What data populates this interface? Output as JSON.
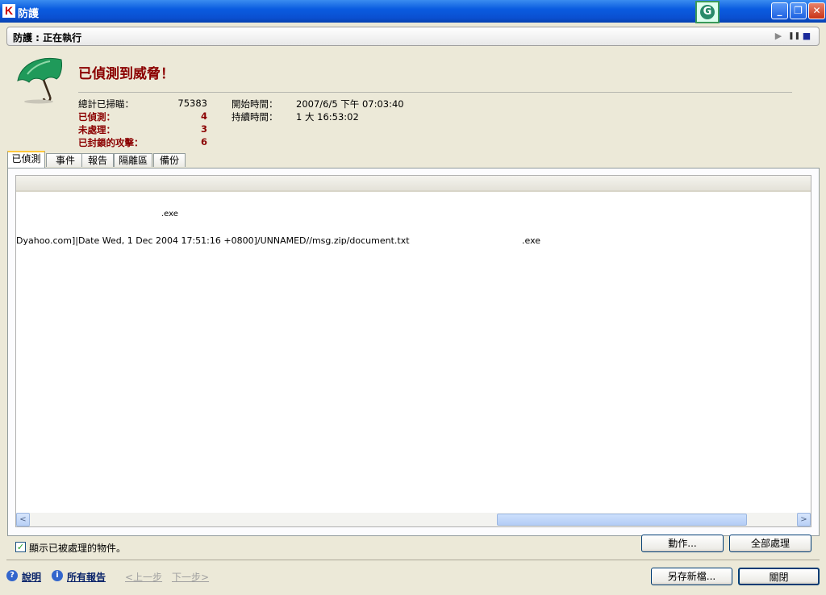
{
  "window": {
    "title": "防護",
    "app_icon_letter": "K",
    "tray_icon_letter": "G",
    "minimize_symbol": "_",
    "restore_symbol": "❐",
    "close_symbol": "✕"
  },
  "status": {
    "text": "防護 : 正在執行",
    "play_symbol": "▶",
    "pause_symbol": "❚❚",
    "stop_symbol": "■"
  },
  "summary": {
    "headline": "已偵測到威脅！",
    "stats": [
      {
        "label": "總計已掃瞄：",
        "value": "75383"
      },
      {
        "label": "已偵測：",
        "value": "4"
      },
      {
        "label": "未處理：",
        "value": "3"
      },
      {
        "label": "已封鎖的攻擊：",
        "value": "6"
      }
    ],
    "start_time_label": "開始時間：",
    "start_time_value": "2007/6/5 下午 07:03:40",
    "duration_label": "持續時間：",
    "duration_value": "1 大 16:53:02"
  },
  "tabs": [
    {
      "label": "已偵測",
      "active": true
    },
    {
      "label": "事件",
      "active": false
    },
    {
      "label": "報告",
      "active": false
    },
    {
      "label": "隔離區",
      "active": false
    },
    {
      "label": "備份",
      "active": false
    }
  ],
  "list": {
    "rows": [
      {
        "col1": "",
        "col2": ".exe"
      },
      {
        "col1": "Dyahoo.com]|Date Wed, 1 Dec 2004 17:51:16 +0800]/UNNAMED//msg.zip/document.txt",
        "col2": ".exe"
      }
    ],
    "scroll_left_symbol": "<",
    "scroll_right_symbol": ">"
  },
  "bottom": {
    "show_processed_label": "顯示已被處理的物件。",
    "show_processed_checked": true,
    "action_button": "動作...",
    "process_all_button": "全部處理",
    "help_link": "說明",
    "all_reports_link": "所有報告",
    "prev_link": "<上一步",
    "next_link": "下一步>",
    "save_as_button": "另存新檔...",
    "close_button": "關閉",
    "help_icon_symbol": "?",
    "info_icon_symbol": "i"
  },
  "colors": {
    "threat_red": "#8b0000",
    "titlebar_blue": "#0a5ce0",
    "umbrella_green": "#1f9a5a"
  }
}
